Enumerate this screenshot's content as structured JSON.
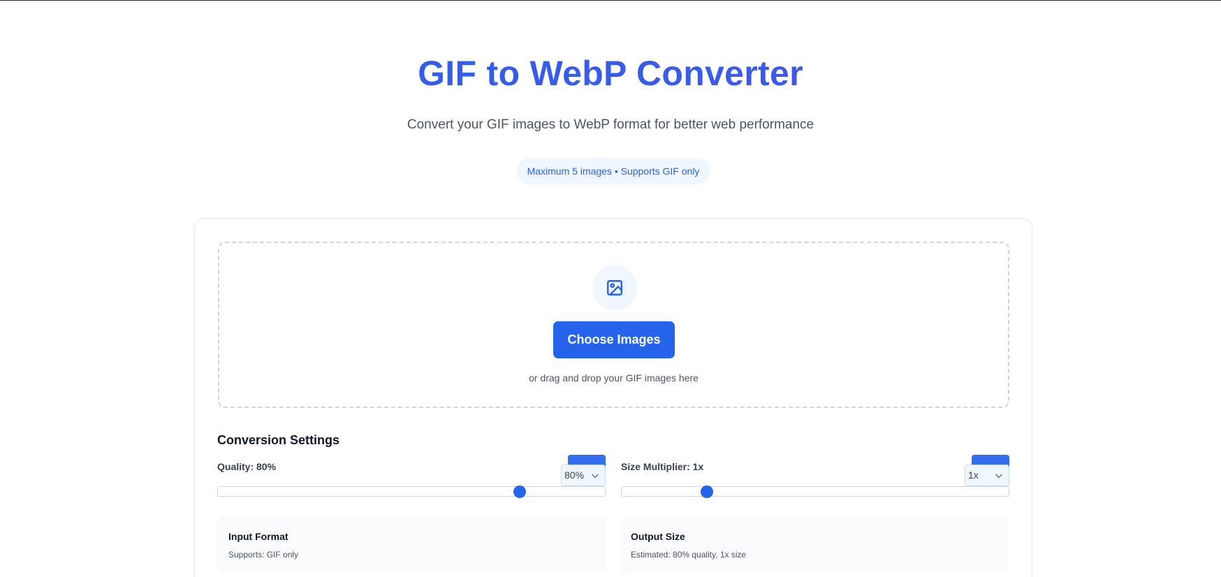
{
  "header": {
    "title": "GIF to WebP Converter",
    "subtitle": "Convert your GIF images to WebP format for better web performance",
    "badge": "Maximum 5 images • Supports GIF only"
  },
  "upload": {
    "icon": "image-icon",
    "button_label": "Choose Images",
    "hint": "or drag and drop your GIF images here"
  },
  "settings": {
    "title": "Conversion Settings",
    "quality": {
      "label": "Quality: 80%",
      "selected": "80%",
      "value_fraction": 0.78
    },
    "size_multiplier": {
      "label": "Size Multiplier: 1x",
      "selected": "1x",
      "value_fraction": 0.22
    }
  },
  "info": {
    "input": {
      "title": "Input Format",
      "text": "Supports: GIF only"
    },
    "output": {
      "title": "Output Size",
      "text": "Estimated: 80% quality, 1x size"
    }
  },
  "colors": {
    "accent": "#2563eb",
    "badge_bg": "#eff6ff",
    "info_bg": "#f9fafb"
  }
}
